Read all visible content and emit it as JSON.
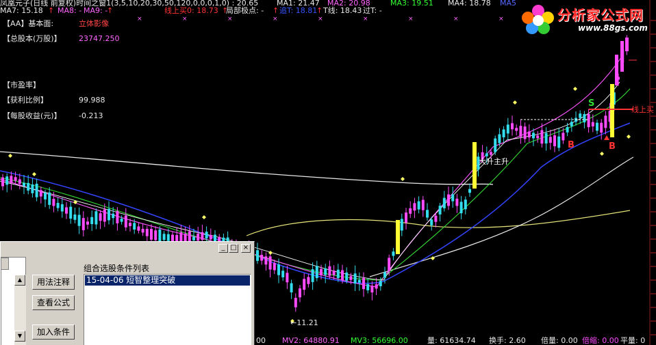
{
  "header": {
    "title": "凤凰元子(日线 前复权)时间之窗1(3,5,10,20,30,50,120,0,0,0,1,0) : 20.65",
    "ma1": "MA1: 21.47",
    "ma2": "MA2: 20.98",
    "ma3": "MA3: 19.51",
    "ma4": "MA4: 18.78",
    "ma5": "MA5",
    "ma7": "MA7: 15.18",
    "ma8": "MA8: -",
    "ma9": "MA9: -",
    "buy_line": "线上买0: 18.73",
    "local_extreme": "局部极点: -",
    "stop": "追T: 18.81",
    "t_line": "T线: 18.43",
    "over_t": "过T: -",
    "mark_a": "↑",
    "mark_b": "↑",
    "mark_c": "↑",
    "mark_d": "↑",
    "mark_e": "↑"
  },
  "fundamentals": {
    "aa_label": "【AA】基本面:",
    "aa_value": "立体影像",
    "shares_label": "【总股本(万股)】",
    "shares_value": "23747.250",
    "pe_label": "【市盈率】",
    "profit_label": "【获利比例】",
    "profit_value": "99.988",
    "eps_label": "【每股收益(元)】",
    "eps_value": "-0.213"
  },
  "logo": {
    "name": "分析家公式网",
    "url": "www.88gs.com"
  },
  "annotations": {
    "low_price": "←11.21",
    "rise": "大升主升",
    "signal_s": "S",
    "signal_b1": "B",
    "signal_b2": "B",
    "line_up": "线上买"
  },
  "bottom": {
    "v1": "00",
    "mv2": "MV2: 64880.91",
    "mv3": "MV3: 56696.00",
    "vol": "量: 61634.74",
    "turnover": "换手: 2.60",
    "ratio": "倍量: 0.00",
    "shrink": "倍缩: 0.00",
    "flat": "平量: 0"
  },
  "window": {
    "btn_min": "_",
    "btn_max": "□",
    "btn_close": "×",
    "btn_usage": "用法注释",
    "btn_formula": "查看公式",
    "btn_add": "加入条件",
    "list_label": "组合选股条件列表",
    "list_items": [
      "15-04-06 短智整理突破"
    ]
  },
  "colors": {
    "up": "#ff4bff",
    "down": "#33ddee",
    "yellow": "#ffff33",
    "background": "#000000"
  },
  "chart_data": {
    "type": "candlestick",
    "low_marker": 11.21
  }
}
